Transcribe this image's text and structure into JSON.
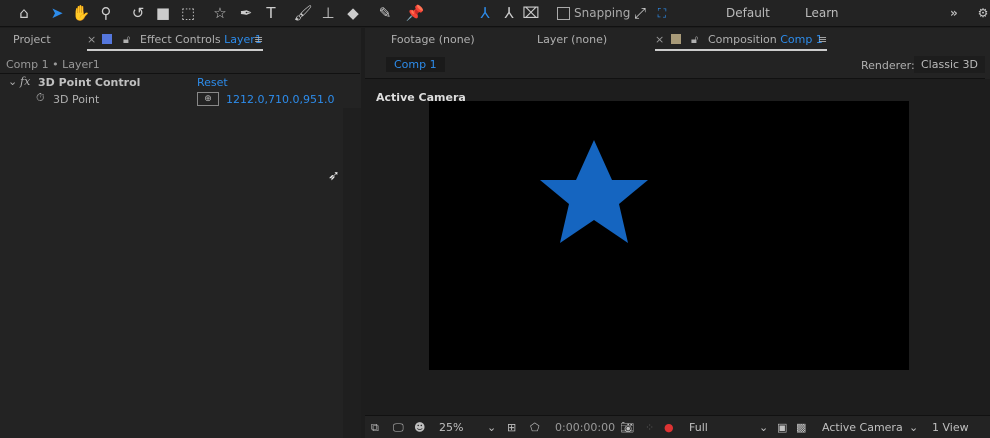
{
  "toolbar": {
    "snapping_label": "Snapping",
    "workspaces": [
      "Default",
      "Learn"
    ],
    "more": "»"
  },
  "left_panel": {
    "tabs": [
      {
        "label": "Project"
      },
      {
        "label": "Effect Controls",
        "target": "Layer1"
      }
    ],
    "breadcrumb": "Comp 1 • Layer1",
    "effect": {
      "fx": "fx",
      "name": "3D Point Control",
      "reset": "Reset",
      "property": "3D Point",
      "value": "1212.0,710.0,951.0"
    }
  },
  "right_panel": {
    "tabs": [
      {
        "label": "Footage (none)"
      },
      {
        "label": "Layer (none)"
      },
      {
        "label": "Composition",
        "target": "Comp 1"
      }
    ],
    "comp_subtab": "Comp 1",
    "renderer_label": "Renderer:",
    "renderer_value": "Classic 3D",
    "view_label": "Active Camera",
    "star_color": "#1565c0",
    "footer": {
      "zoom": "25%",
      "timecode": "0:00:00:00",
      "resolution": "Full",
      "camera": "Active Camera",
      "views": "1 View"
    }
  },
  "colors": {
    "accent": "#2d8ceb",
    "layer_label": "#5577dd",
    "comp_label": "#a89a78"
  }
}
